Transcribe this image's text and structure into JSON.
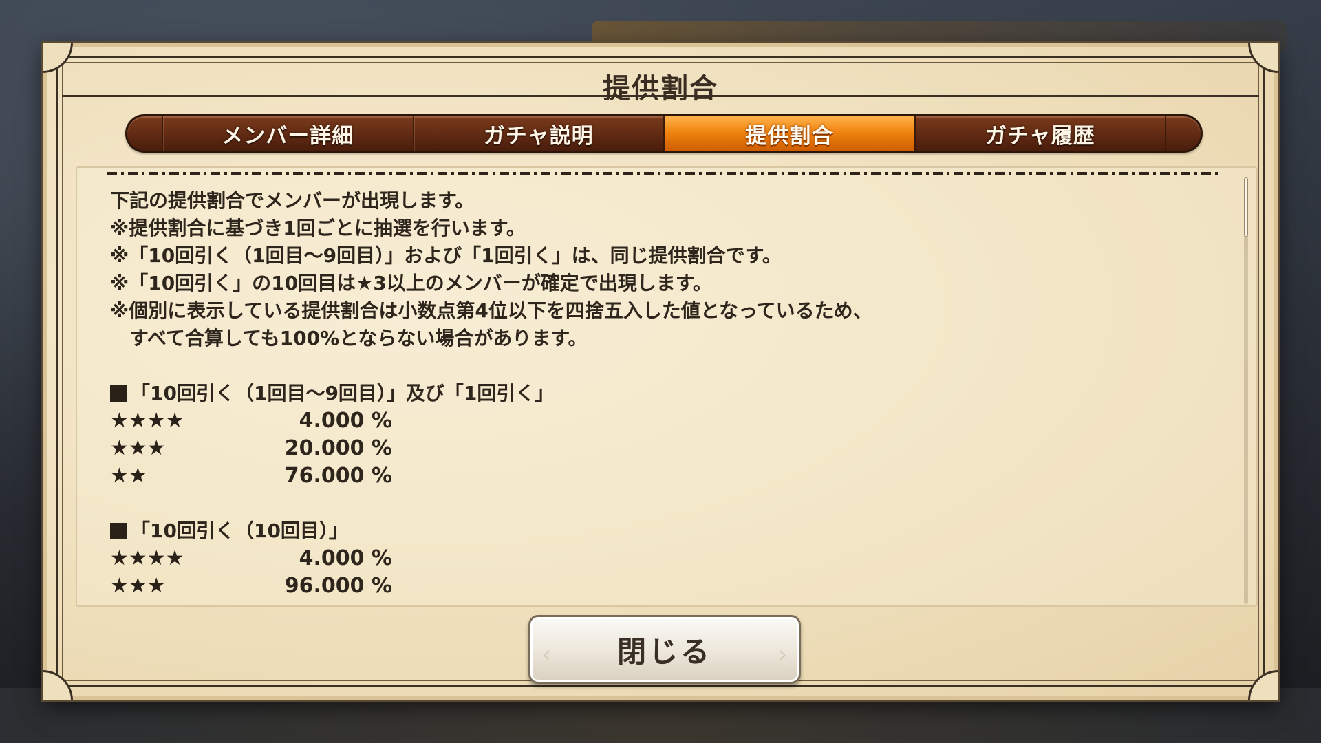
{
  "dialog": {
    "title": "提供割合"
  },
  "tabs": [
    {
      "label": "メンバー詳細",
      "active": false
    },
    {
      "label": "ガチャ説明",
      "active": false
    },
    {
      "label": "提供割合",
      "active": true
    },
    {
      "label": "ガチャ履歴",
      "active": false
    }
  ],
  "notes": [
    "下記の提供割合でメンバーが出現します。",
    "※提供割合に基づき1回ごとに抽選を行います。",
    "※「10回引く（1回目～9回目）」および「1回引く」は、同じ提供割合です。",
    "※「10回引く」の10回目は★3以上のメンバーが確定で出現します。",
    "※個別に表示している提供割合は小数点第4位以下を四捨五入した値となっているため、",
    "　すべて合算しても100%とならない場合があります。"
  ],
  "sections": [
    {
      "heading": "「10回引く（1回目～9回目）」及び「1回引く」",
      "rows": [
        {
          "stars": "★★★★",
          "rate": "4.000 %"
        },
        {
          "stars": "★★★",
          "rate": "20.000 %"
        },
        {
          "stars": "★★",
          "rate": "76.000 %"
        }
      ]
    },
    {
      "heading": "「10回引く（10回目）」",
      "rows": [
        {
          "stars": "★★★★",
          "rate": "4.000 %"
        },
        {
          "stars": "★★★",
          "rate": "96.000 %"
        }
      ]
    }
  ],
  "close_button": {
    "label": "閉じる"
  },
  "colors": {
    "active_tab": "#f08512",
    "tab_bar": "#5a250f",
    "parchment": "#efe0bd",
    "text": "#2e261c"
  }
}
